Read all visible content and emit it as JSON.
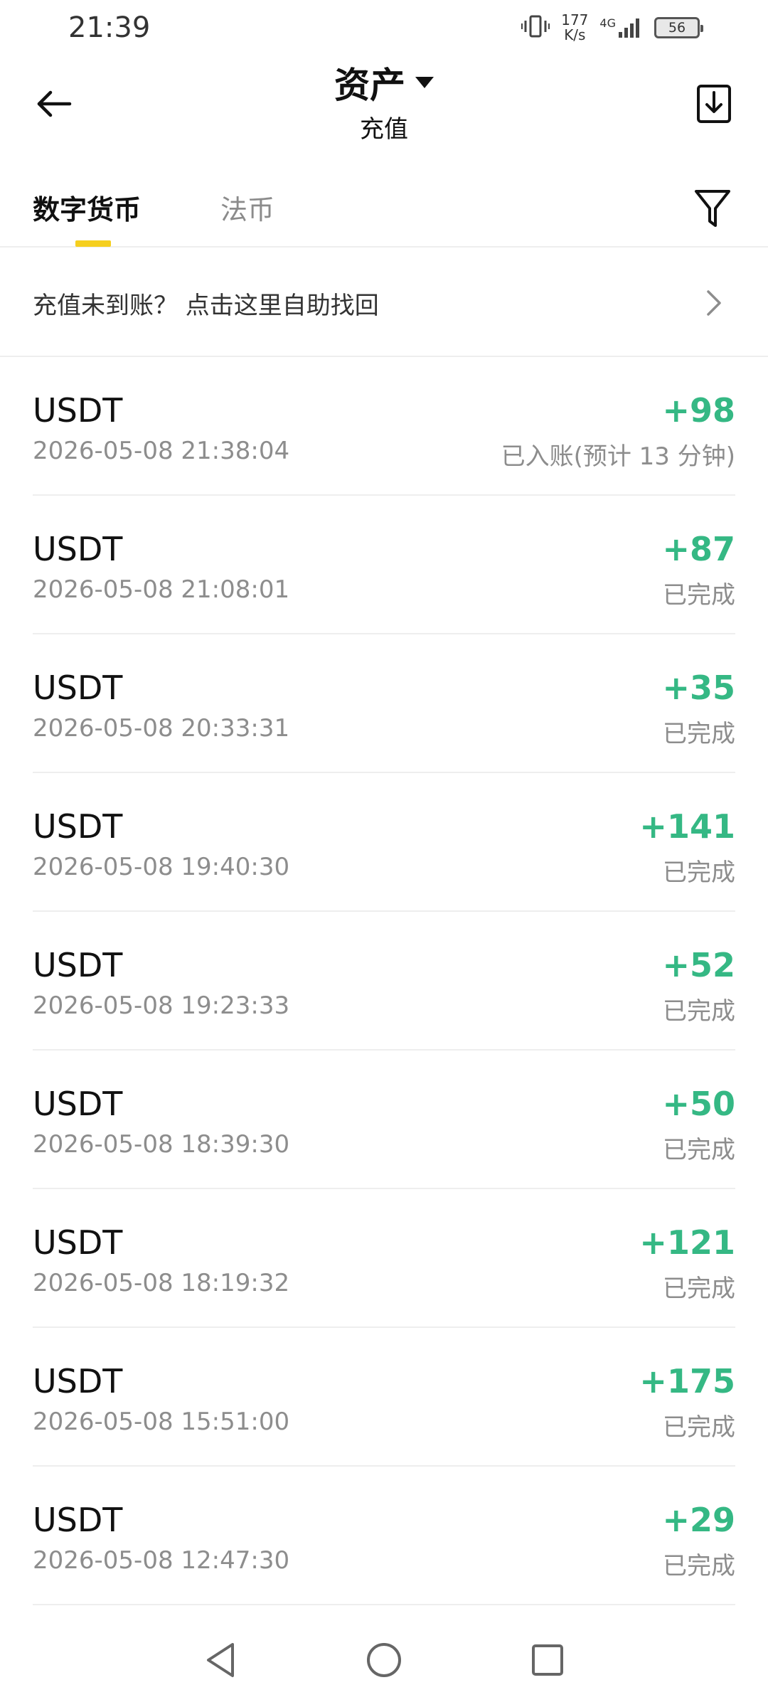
{
  "status_bar": {
    "time": "21:39",
    "net_speed_value": "177",
    "net_speed_unit": "K/s",
    "network_label": "4G",
    "battery": "56"
  },
  "header": {
    "title": "资产",
    "subtitle": "充值"
  },
  "tabs": [
    {
      "label": "数字货币",
      "active": true
    },
    {
      "label": "法币",
      "active": false
    }
  ],
  "help_banner": {
    "text": "充值未到账？ 点击这里自助找回"
  },
  "records": [
    {
      "coin": "USDT",
      "time": "2026-05-08 21:38:04",
      "amount": "+98",
      "status": "已入账(预计 13 分钟)"
    },
    {
      "coin": "USDT",
      "time": "2026-05-08 21:08:01",
      "amount": "+87",
      "status": "已完成"
    },
    {
      "coin": "USDT",
      "time": "2026-05-08 20:33:31",
      "amount": "+35",
      "status": "已完成"
    },
    {
      "coin": "USDT",
      "time": "2026-05-08 19:40:30",
      "amount": "+141",
      "status": "已完成"
    },
    {
      "coin": "USDT",
      "time": "2026-05-08 19:23:33",
      "amount": "+52",
      "status": "已完成"
    },
    {
      "coin": "USDT",
      "time": "2026-05-08 18:39:30",
      "amount": "+50",
      "status": "已完成"
    },
    {
      "coin": "USDT",
      "time": "2026-05-08 18:19:32",
      "amount": "+121",
      "status": "已完成"
    },
    {
      "coin": "USDT",
      "time": "2026-05-08 15:51:00",
      "amount": "+175",
      "status": "已完成"
    },
    {
      "coin": "USDT",
      "time": "2026-05-08 12:47:30",
      "amount": "+29",
      "status": "已完成"
    }
  ],
  "icons": {
    "back": "arrow-left-icon",
    "export": "download-icon",
    "filter": "filter-icon",
    "chevron": "chevron-right-icon",
    "nav_back": "triangle-back-icon",
    "nav_home": "circle-home-icon",
    "nav_recent": "square-recent-icon"
  },
  "colors": {
    "accent": "#f5cf1f",
    "positive": "#35b884",
    "muted": "#8d8d8d"
  }
}
